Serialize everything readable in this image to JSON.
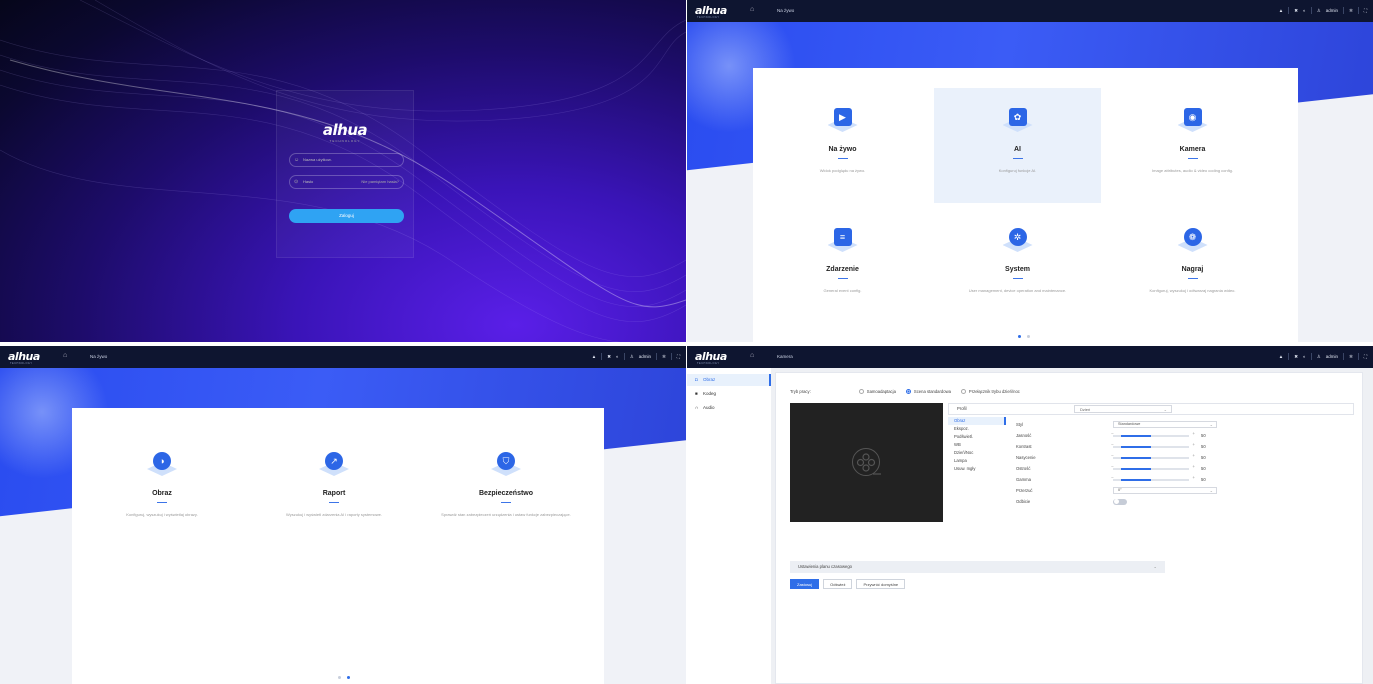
{
  "brand": {
    "logo": "alhua",
    "sub": "TECHNOLOGY"
  },
  "login": {
    "username_placeholder": "Nazwa użytkow.",
    "password_placeholder": "Hasło",
    "forgot_label": "Nie pamiętam hasła?",
    "submit_label": "Zaloguj"
  },
  "topbar": {
    "user": "admin",
    "icons": [
      "bell-icon",
      "tools-icon",
      "refresh-icon",
      "user-icon",
      "gear-icon",
      "fullscreen-icon"
    ]
  },
  "home1": {
    "breadcrumb": "Na żywo",
    "tiles": [
      {
        "title": "Na żywo",
        "desc": "Widok podglądu na żywo.",
        "icon": "play-icon",
        "selected": false
      },
      {
        "title": "AI",
        "desc": "Konfiguruj funkcje AI.",
        "icon": "ai-brain-icon",
        "selected": true
      },
      {
        "title": "Kamera",
        "desc": "Image attributes, audio & video coding config.",
        "icon": "camera-icon",
        "selected": false
      },
      {
        "title": "Zdarzenie",
        "desc": "General event config.",
        "icon": "event-list-icon",
        "selected": false
      },
      {
        "title": "System",
        "desc": "User management, device operation and maintenance.",
        "icon": "system-gear-icon",
        "selected": false
      },
      {
        "title": "Nagraj",
        "desc": "Konfiguruj, wyszukuj i odtwarzaj nagrania wideo.",
        "icon": "film-reel-icon",
        "selected": false
      }
    ]
  },
  "home2": {
    "breadcrumb": "Na żywo",
    "tiles": [
      {
        "title": "Obraz",
        "desc": "Konfiguruj, wyszukuj i wyświetlaj obrazy.",
        "icon": "image-icon"
      },
      {
        "title": "Raport",
        "desc": "Wyszukuj i wyświetl zdarzenia AI i raporty systemowe.",
        "icon": "report-chart-icon"
      },
      {
        "title": "Bezpieczeństwo",
        "desc": "Sprawdź stan zabezpieczeń urządzenia i ustaw funkcje zabezpieczające.",
        "icon": "shield-icon"
      }
    ]
  },
  "camera": {
    "breadcrumb": "Kamera",
    "sidebar": [
      {
        "label": "Obraz",
        "icon": "camera-small-icon",
        "active": true
      },
      {
        "label": "Kodeg",
        "icon": "encode-icon",
        "active": false
      },
      {
        "label": "Audio",
        "icon": "headphones-icon",
        "active": false
      }
    ],
    "mode_label": "Tryb pracy:",
    "mode_options": [
      {
        "label": "Samoadaptacja",
        "selected": false
      },
      {
        "label": "Scena standardowa",
        "selected": true
      },
      {
        "label": "Przełącznik trybu dzień/noc",
        "selected": false
      }
    ],
    "profile_label": "Profil",
    "profile_value": "Dzień",
    "submenu": [
      "Obraz",
      "Ekspoz.",
      "Podświetl.",
      "WB",
      "Dzień/Noc",
      "Lampa",
      "Usuw. mgły"
    ],
    "params": {
      "style_label": "Styl",
      "style_value": "Standardowe",
      "sliders": [
        {
          "label": "Jasność",
          "value": "50",
          "fraction": 0.5
        },
        {
          "label": "Kontrast",
          "value": "50",
          "fraction": 0.5
        },
        {
          "label": "Nasycenie",
          "value": "50",
          "fraction": 0.5
        },
        {
          "label": "Ostrość",
          "value": "50",
          "fraction": 0.5
        },
        {
          "label": "Gamma",
          "value": "50",
          "fraction": 0.5
        }
      ],
      "rotate_label": "Przerzuć",
      "rotate_value": "0°",
      "mirror_label": "Odbicie",
      "mirror_on": false
    },
    "schedule_label": "Ustawienia planu czasowego",
    "buttons": {
      "apply": "Zastosuj",
      "refresh": "Odśwież",
      "default": "Przywróć domyślne"
    }
  }
}
